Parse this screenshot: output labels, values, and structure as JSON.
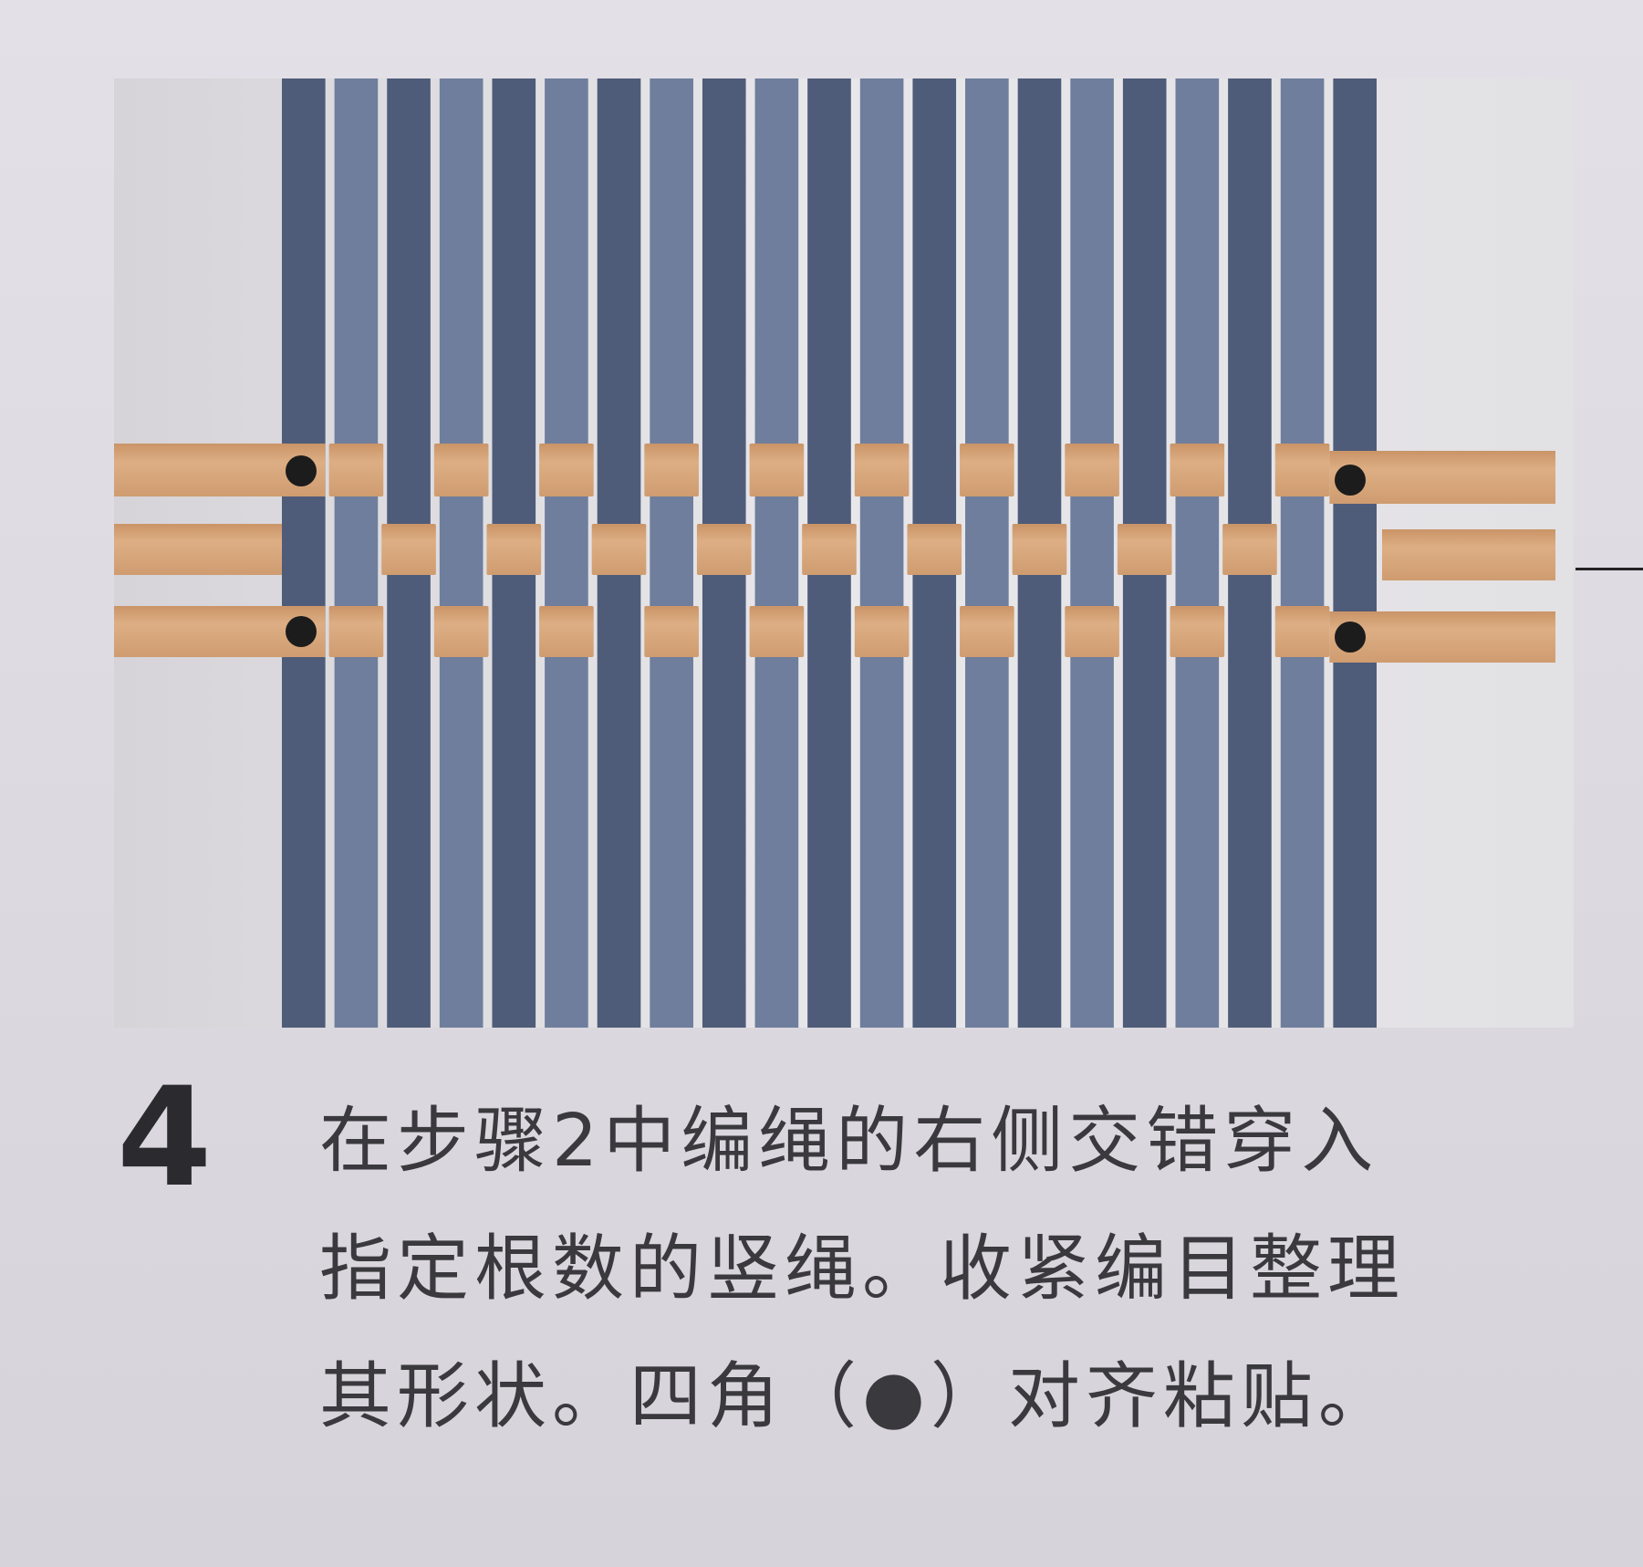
{
  "step": {
    "number": "4",
    "instruction_lines": [
      "在步骤2中编绳的右侧交错穿入",
      "指定根数的竖绳。收紧编目整理",
      "其形状。四角（●）对齐粘贴。"
    ]
  },
  "photo": {
    "vertical_strands": 21,
    "horizontal_strands": 3,
    "corner_markers": 4,
    "colors": {
      "background": "#e4e3e6",
      "vertical_strand": "#6f7e9c",
      "vertical_strand_dark": "#4f5c79",
      "horizontal_strand": "#d8a77b",
      "marker": "#1c1c1c"
    }
  }
}
